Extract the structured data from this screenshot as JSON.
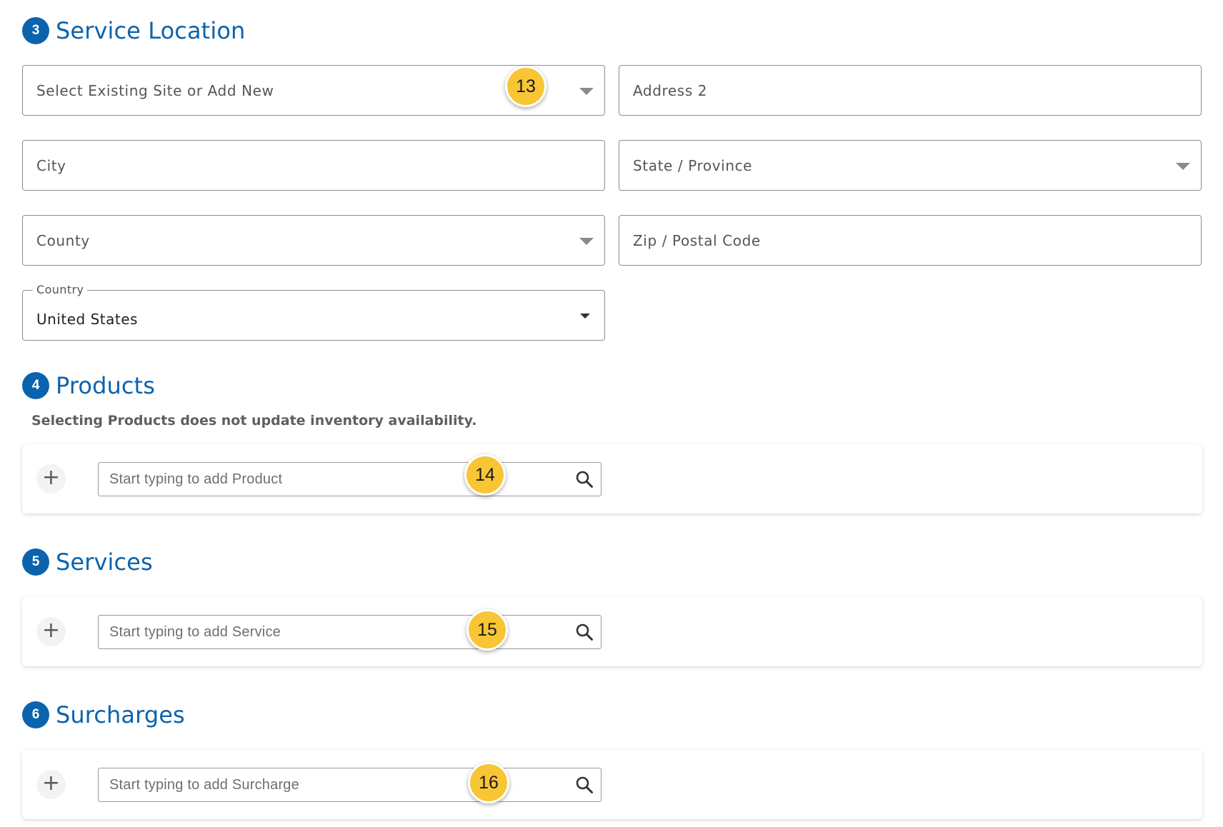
{
  "service_location": {
    "step": "3",
    "title": "Service Location",
    "site_select": {
      "placeholder": "Select Existing Site or Add New",
      "badge": "13"
    },
    "address2": {
      "placeholder": "Address 2"
    },
    "city": {
      "placeholder": "City"
    },
    "state": {
      "placeholder": "State / Province"
    },
    "county": {
      "placeholder": "County"
    },
    "zip": {
      "placeholder": "Zip / Postal Code"
    },
    "country": {
      "label": "Country",
      "value": "United States"
    }
  },
  "products": {
    "step": "4",
    "title": "Products",
    "note": "Selecting Products does not update inventory availability.",
    "add_label": "+",
    "search_placeholder": "Start typing to add Product",
    "badge": "14"
  },
  "services": {
    "step": "5",
    "title": "Services",
    "add_label": "+",
    "search_placeholder": "Start typing to add Service",
    "badge": "15"
  },
  "surcharges": {
    "step": "6",
    "title": "Surcharges",
    "add_label": "+",
    "search_placeholder": "Start typing to add Surcharge",
    "badge": "16"
  },
  "colors": {
    "accent": "#0b63ad",
    "badge": "#f8c634"
  },
  "icons": {
    "dropdown": "caret-down-icon",
    "search": "magnifier-icon",
    "add": "plus-icon"
  }
}
